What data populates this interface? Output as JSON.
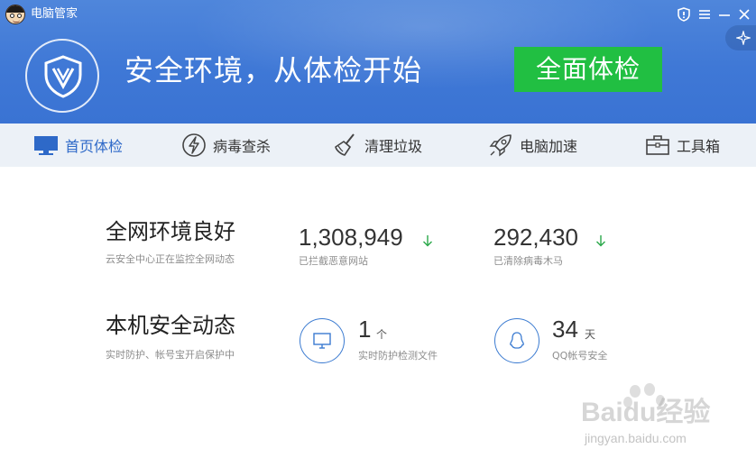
{
  "app": {
    "title": "电脑管家"
  },
  "header": {
    "slogan": "安全环境，从体检开始",
    "scan_button": "全面体检"
  },
  "nav": {
    "items": [
      {
        "label": "首页体检",
        "icon": "monitor-icon",
        "active": true
      },
      {
        "label": "病毒查杀",
        "icon": "lightning-icon",
        "active": false
      },
      {
        "label": "清理垃圾",
        "icon": "broom-icon",
        "active": false
      },
      {
        "label": "电脑加速",
        "icon": "rocket-icon",
        "active": false
      },
      {
        "label": "工具箱",
        "icon": "toolbox-icon",
        "active": false
      }
    ]
  },
  "network": {
    "title": "全网环境良好",
    "subtitle": "云安全中心正在监控全网动态",
    "stat1": {
      "value": "1,308,949",
      "caption": "已拦截恶意网站"
    },
    "stat2": {
      "value": "292,430",
      "caption": "已清除病毒木马"
    }
  },
  "local": {
    "title": "本机安全动态",
    "subtitle": "实时防护、帐号宝开启保护中",
    "stat1": {
      "value": "1",
      "unit": "个",
      "caption": "实时防护检测文件",
      "icon": "monitor-icon"
    },
    "stat2": {
      "value": "34",
      "unit": "天",
      "caption": "QQ帐号安全",
      "icon": "qq-penguin-icon"
    }
  },
  "watermark": {
    "logo": "Baidu经验",
    "url": "jingyan.baidu.com"
  },
  "colors": {
    "header_blue": "#4080d8",
    "accent_green": "#21bf42",
    "nav_active": "#2e69c8",
    "arrow_green": "#2aa84a"
  }
}
